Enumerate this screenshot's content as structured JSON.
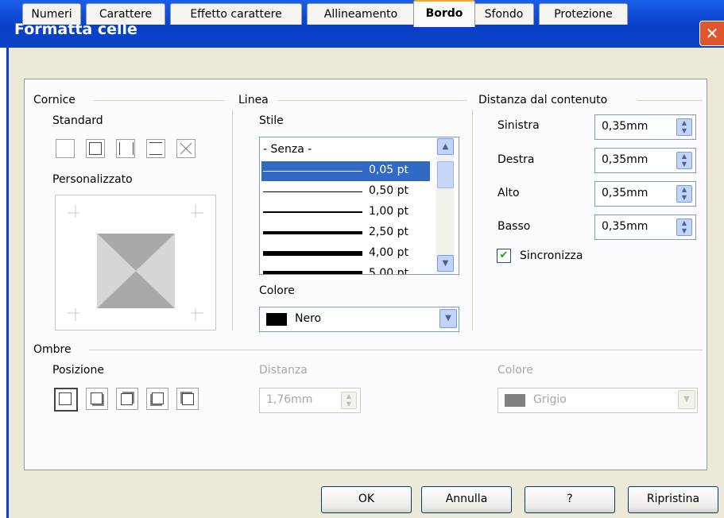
{
  "dialog": {
    "title": "Formatta celle",
    "close_glyph": "✕"
  },
  "tabs": [
    {
      "label": "Numeri"
    },
    {
      "label": "Carattere"
    },
    {
      "label": "Effetto carattere"
    },
    {
      "label": "Allineamento"
    },
    {
      "label": "Bordo",
      "active": true
    },
    {
      "label": "Sfondo"
    },
    {
      "label": "Protezione"
    }
  ],
  "cornice": {
    "title": "Cornice",
    "standard_label": "Standard",
    "custom_label": "Personalizzato"
  },
  "linea": {
    "title": "Linea",
    "stile_label": "Stile",
    "styles": [
      {
        "label": "- Senza -"
      },
      {
        "label": "0,05 pt",
        "selected": true
      },
      {
        "label": "0,50 pt"
      },
      {
        "label": "1,00 pt"
      },
      {
        "label": "2,50 pt"
      },
      {
        "label": "4,00 pt"
      },
      {
        "label": "5,00 pt"
      }
    ],
    "colore_label": "Colore",
    "colore_value": "Nero",
    "colore_swatch": "#000000"
  },
  "distanza": {
    "title": "Distanza dal contenuto",
    "sinistra_label": "Sinistra",
    "sinistra_value": "0,35mm",
    "destra_label": "Destra",
    "destra_value": "0,35mm",
    "alto_label": "Alto",
    "alto_value": "0,35mm",
    "basso_label": "Basso",
    "basso_value": "0,35mm",
    "sincronizza_label": "Sincronizza",
    "sincronizza_checked": true
  },
  "ombre": {
    "title": "Ombre",
    "posizione_label": "Posizione",
    "distanza_label": "Distanza",
    "distanza_value": "1,76mm",
    "colore_label": "Colore",
    "colore_value": "Grigio",
    "colore_swatch": "#808080"
  },
  "buttons": {
    "ok": "OK",
    "annulla": "Annulla",
    "aiuto": "?",
    "ripristina": "Ripristina"
  }
}
